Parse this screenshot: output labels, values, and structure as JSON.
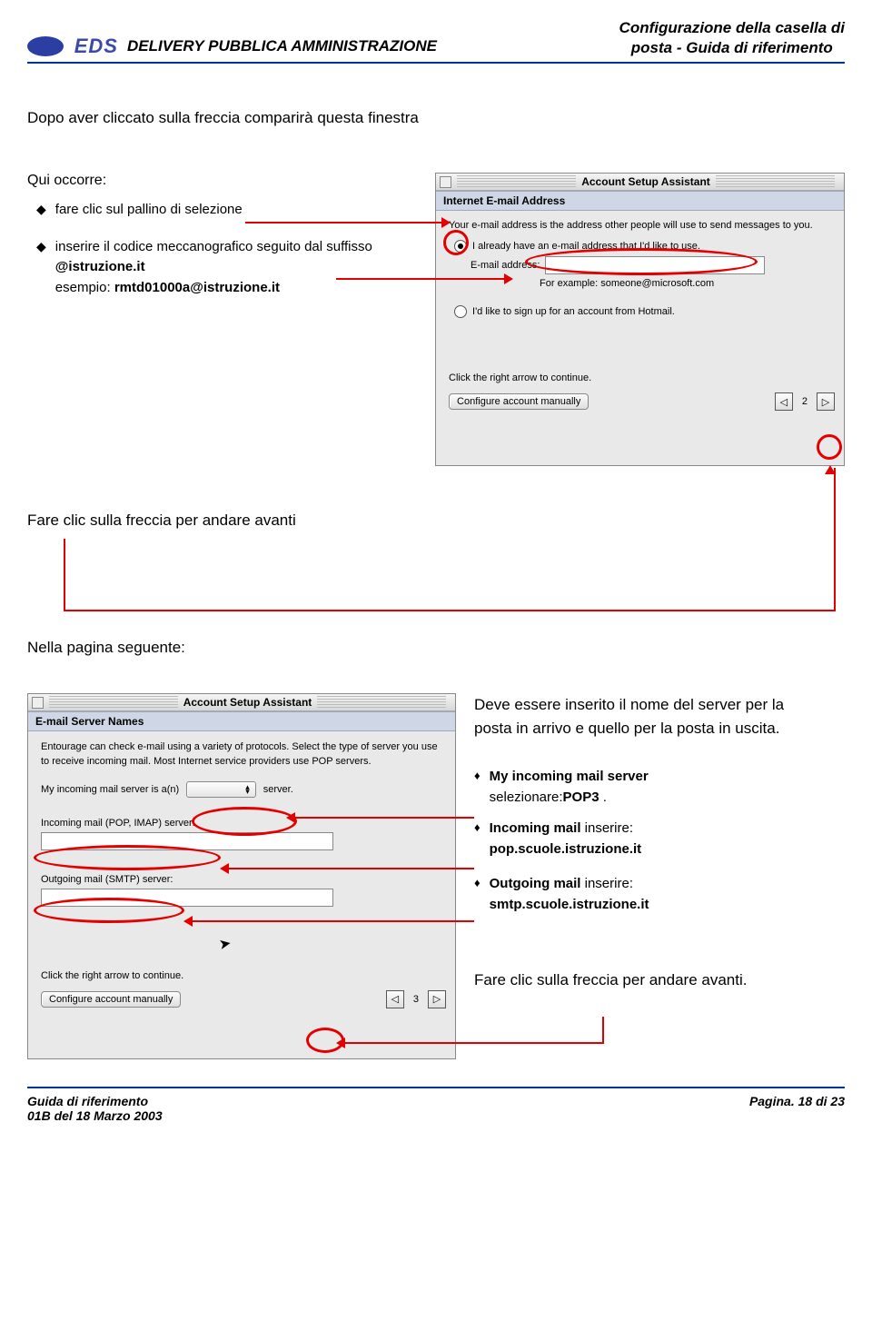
{
  "header": {
    "logo_text": "EDS",
    "left_title": "DELIVERY PUBBLICA AMMINISTRAZIONE",
    "right_title_line1": "Configurazione della casella di",
    "right_title_line2": "posta - Guida di riferimento"
  },
  "section1": {
    "intro": "Dopo aver cliccato sulla freccia comparirà questa finestra",
    "qui_occorre": "Qui occorre:",
    "bullet1": "fare clic sul pallino di selezione",
    "bullet2a": "inserire il codice meccanografico seguito dal suffisso ",
    "bullet2b": "@istruzione.it",
    "bullet2c": "esempio: ",
    "bullet2d": "rmtd01000a@istruzione.it"
  },
  "wizard1": {
    "title": "Account Setup Assistant",
    "subheader": "Internet E-mail Address",
    "desc": "Your e-mail address is the address other people will use to send messages to you.",
    "radio1": "I already have an e-mail address that I'd like to use.",
    "field_label": "E-mail address:",
    "example": "For example: someone@microsoft.com",
    "radio2": "I'd like to sign up for an account from Hotmail.",
    "click_hint": "Click the right arrow to continue.",
    "config_btn": "Configure account manually",
    "page": "2"
  },
  "fare_clic": "Fare clic sulla freccia per andare avanti",
  "next_page": "Nella pagina seguente:",
  "wizard2": {
    "title": "Account Setup Assistant",
    "subheader": "E-mail Server Names",
    "desc": "Entourage can check e-mail using a variety of protocols. Select the type of server you use to receive incoming mail. Most Internet service providers use POP servers.",
    "row_server_is": "My incoming mail server is a(n)",
    "row_server_tail": "server.",
    "row_incoming": "Incoming mail (POP, IMAP) server:",
    "row_outgoing": "Outgoing mail (SMTP) server:",
    "click_hint": "Click the right arrow to continue.",
    "config_btn": "Configure account manually",
    "page": "3"
  },
  "right_notes": {
    "note1": "Deve essere inserito il nome del server per la posta in arrivo e quello per la posta in uscita.",
    "d1a": "My incoming mail server",
    "d1b": "selezionare:",
    "d1c": "POP3",
    "d1d": " .",
    "d2a": "Incoming mail",
    "d2b": " inserire:",
    "d2c": "pop.scuole.istruzione.it",
    "d3a": "Outgoing mail",
    "d3b": " inserire:",
    "d3c": "smtp.scuole.istruzione.it",
    "final": "Fare clic sulla freccia per andare avanti."
  },
  "footer": {
    "left_line1": "Guida di riferimento",
    "left_line2": "01B del 18 Marzo 2003",
    "right": "Pagina. 18 di 23"
  }
}
